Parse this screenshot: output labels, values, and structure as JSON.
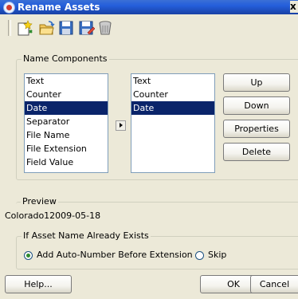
{
  "window": {
    "title": "Rename Assets",
    "close_label": "x"
  },
  "toolbar": {
    "icons": [
      "new-icon",
      "open-icon",
      "save-icon",
      "save-as-icon",
      "delete-icon"
    ]
  },
  "name_components": {
    "label": "Name Components",
    "available": [
      "Text",
      "Counter",
      "Date",
      "Separator",
      "File Name",
      "File Extension",
      "Field Value"
    ],
    "available_selected": "Date",
    "selected": [
      "Text",
      "Counter",
      "Date"
    ],
    "selected_selected": "Date",
    "buttons": {
      "up": "Up",
      "down": "Down",
      "properties": "Properties",
      "delete": "Delete"
    }
  },
  "preview": {
    "label": "Preview",
    "value": "Colorado12009-05-18"
  },
  "exists": {
    "label": "If Asset Name Already Exists",
    "options": [
      {
        "label": "Add Auto-Number Before Extension",
        "checked": true
      },
      {
        "label": "Skip",
        "checked": false
      }
    ]
  },
  "footer": {
    "help": "Help...",
    "ok": "OK",
    "cancel": "Cancel"
  }
}
